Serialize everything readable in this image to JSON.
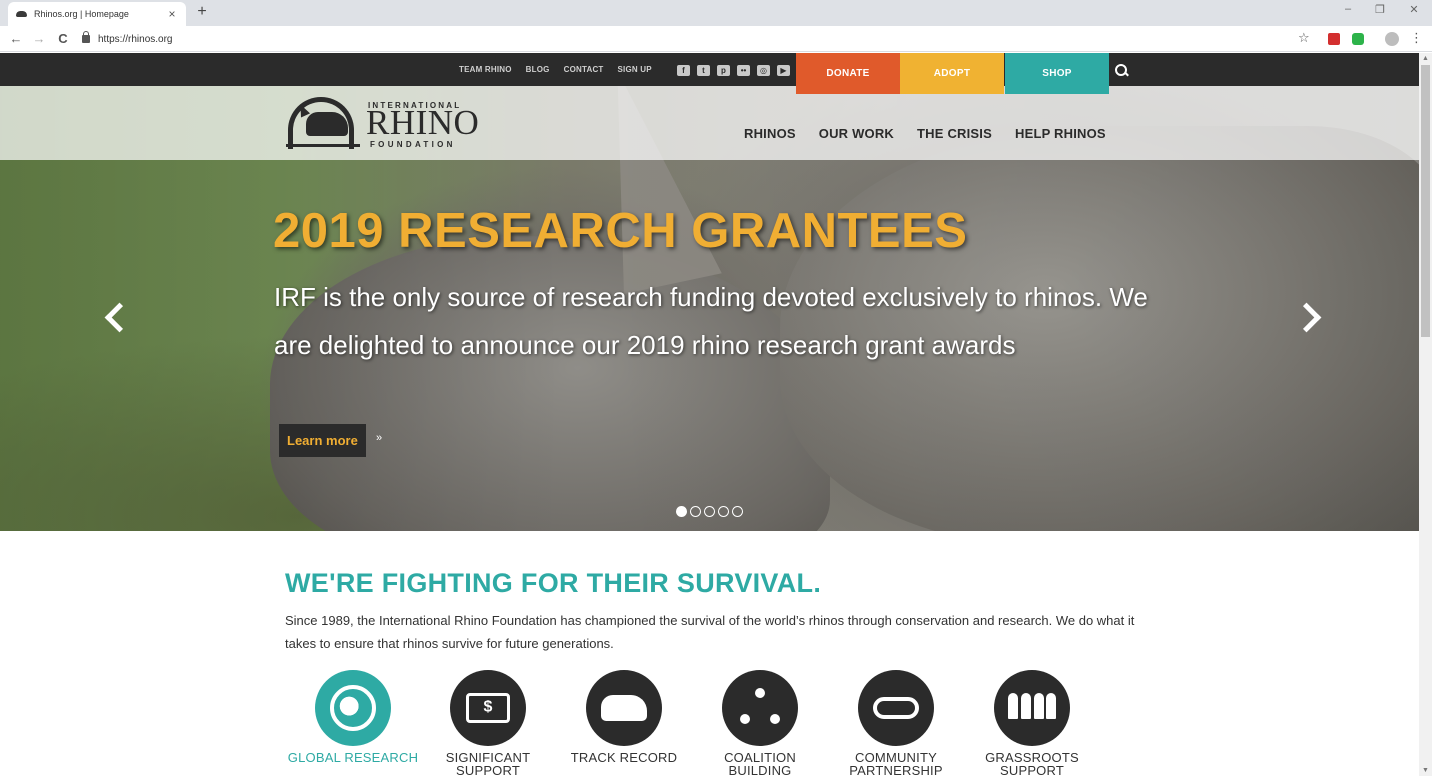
{
  "browser": {
    "tab_title": "Rhinos.org | Homepage",
    "tab_close": "×",
    "new_tab": "+",
    "url": "https://rhinos.org",
    "back": "←",
    "forward": "→",
    "reload": "C",
    "star": "☆",
    "menu": "⋮",
    "window_controls": [
      "–",
      "❐",
      "✕"
    ]
  },
  "utility_nav": {
    "links": [
      "TEAM RHINO",
      "BLOG",
      "CONTACT",
      "SIGN UP"
    ],
    "socials": [
      "facebook-icon",
      "twitter-icon",
      "pinterest-icon",
      "flickr-icon",
      "instagram-icon",
      "youtube-icon"
    ],
    "social_glyphs": [
      "f",
      "t",
      "p",
      "••",
      "◎",
      "▶"
    ]
  },
  "cta": [
    {
      "label": "DONATE",
      "color": "#e05a2b"
    },
    {
      "label": "ADOPT",
      "color": "#f0b232"
    },
    {
      "label": "SHOP",
      "color": "#2eaaa4"
    }
  ],
  "logo": {
    "top_text": "INTERNATIONAL",
    "main_text": "RHINO",
    "bottom_text": "FOUNDATION"
  },
  "main_nav": [
    "RHINOS",
    "OUR WORK",
    "THE CRISIS",
    "HELP RHINOS"
  ],
  "hero": {
    "title": "2019 RESEARCH GRANTEES",
    "text": "IRF is the only source of research funding devoted exclusively to rhinos. We are delighted to announce our 2019 rhino research grant awards",
    "button": "Learn more",
    "button_suffix": "»",
    "slides_total": 5,
    "active_slide": 1
  },
  "mission": {
    "title": "WE'RE FIGHTING FOR THEIR SURVIVAL.",
    "text": "Since 1989, the International Rhino Foundation has championed the survival of the world’s rhinos through conservation and research. We do what it takes to ensure that rhinos survive for future generations."
  },
  "features": [
    {
      "label": "GLOBAL RESEARCH",
      "icon": "globe-icon",
      "active": true
    },
    {
      "label": "SIGNIFICANT SUPPORT",
      "icon": "money-icon",
      "active": false
    },
    {
      "label": "TRACK RECORD",
      "icon": "rhino-icon",
      "active": false
    },
    {
      "label": "COALITION BUILDING",
      "icon": "people-network-icon",
      "active": false
    },
    {
      "label": "COMMUNITY PARTNERSHIP",
      "icon": "handshake-icon",
      "active": false
    },
    {
      "label": "GRASSROOTS SUPPORT",
      "icon": "group-icon",
      "active": false
    }
  ],
  "colors": {
    "accent_teal": "#2eaaa4",
    "accent_gold": "#f0ae33",
    "dark": "#2b2b2b"
  }
}
